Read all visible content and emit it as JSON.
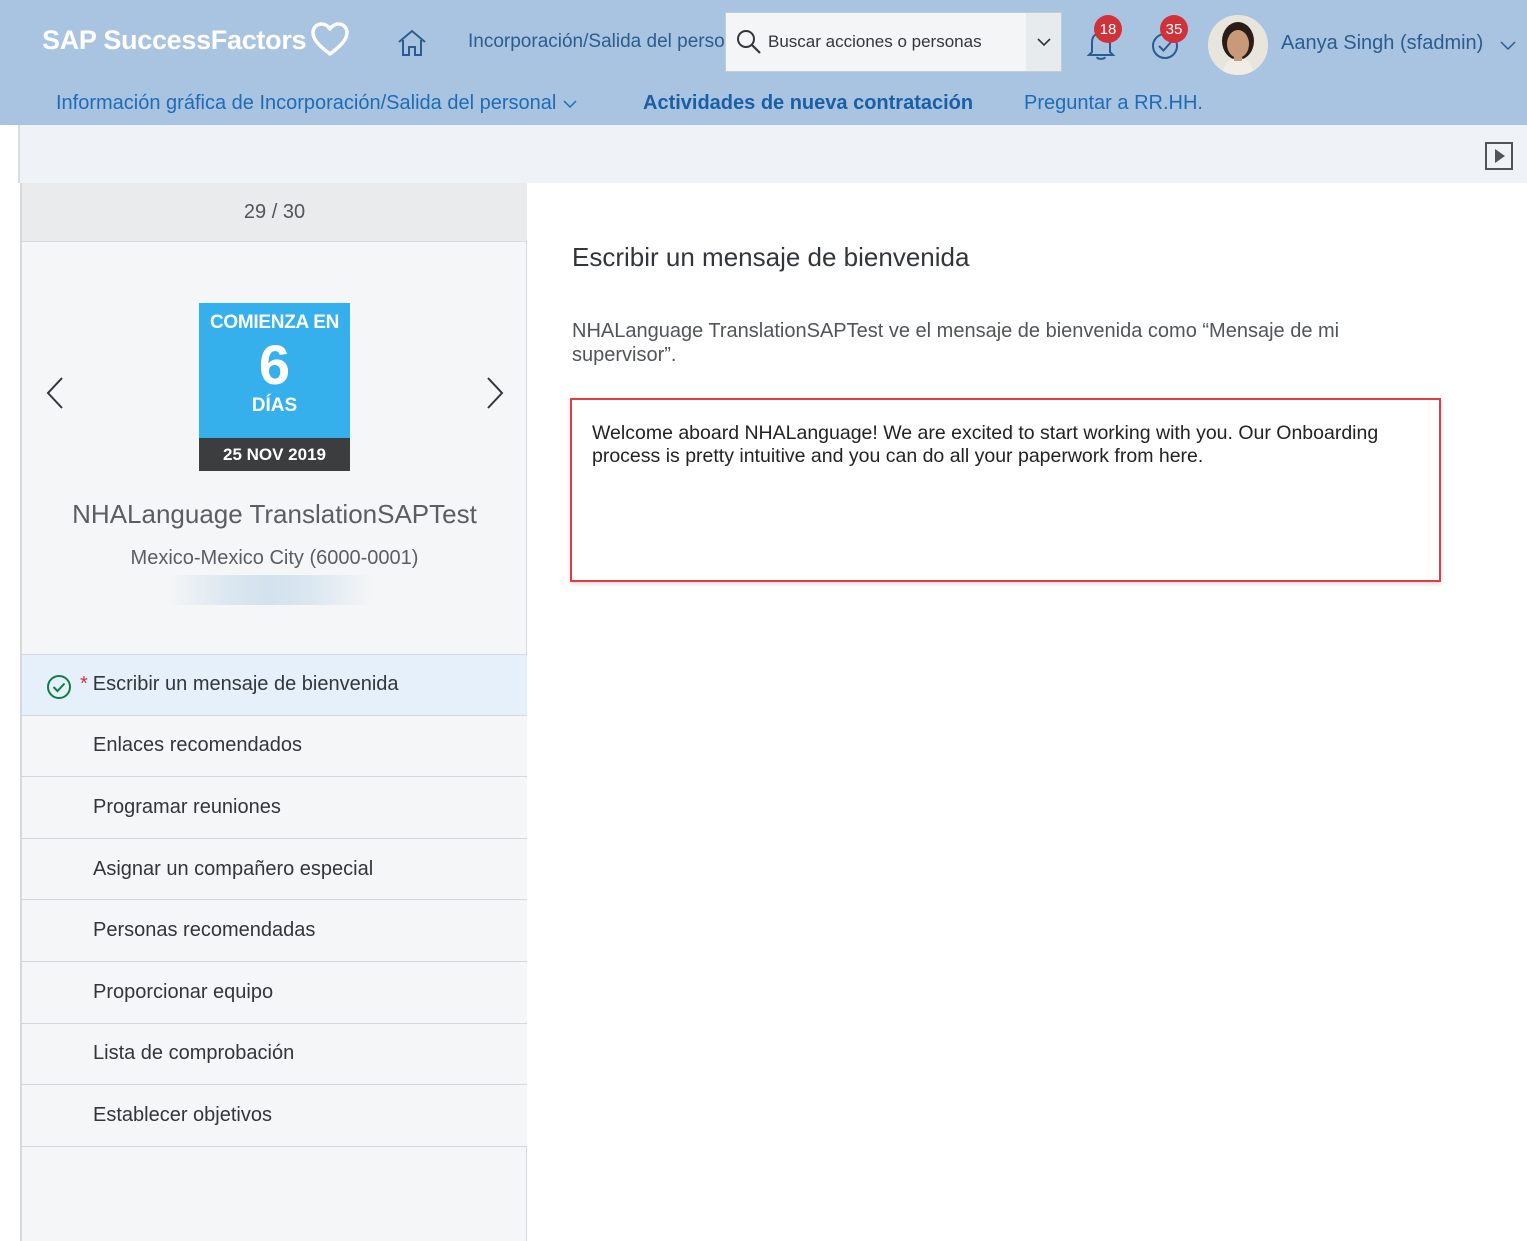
{
  "header": {
    "logo_text": "SAP SuccessFactors",
    "module_label": "Incorporación/Salida del personal",
    "search_placeholder": "Buscar acciones o personas",
    "notifications_count": "18",
    "todo_count": "35",
    "user_name": "Aanya Singh (sfadmin)"
  },
  "subnav": {
    "items": [
      {
        "label": "Información gráfica de Incorporación/Salida del personal"
      },
      {
        "label": "Actividades de nueva contratación"
      },
      {
        "label": "Preguntar a RR.HH."
      }
    ]
  },
  "sidebar": {
    "counter": "29 / 30",
    "calendar": {
      "line1": "COMIENZA EN",
      "number": "6",
      "line3": "DÍAS",
      "date": "25 NOV 2019"
    },
    "person_name": "NHALanguage TranslationSAPTest",
    "location": "Mexico-Mexico City (6000-0001)",
    "tasks": [
      {
        "label": "Escribir un mensaje de bienvenida",
        "required_marker": "*",
        "done": true
      },
      {
        "label": "Enlaces recomendados"
      },
      {
        "label": "Programar reuniones"
      },
      {
        "label": "Asignar un compañero especial"
      },
      {
        "label": "Personas recomendadas"
      },
      {
        "label": "Proporcionar equipo"
      },
      {
        "label": "Lista de comprobación"
      },
      {
        "label": "Establecer objetivos"
      }
    ]
  },
  "main": {
    "title": "Escribir un mensaje de bienvenida",
    "description": "NHALanguage TranslationSAPTest ve el mensaje de bienvenida como “Mensaje de mi supervisor”.",
    "message": "Welcome aboard NHALanguage! We are excited to start working with you. Our Onboarding process is pretty intuitive and you can do all your paperwork from here."
  },
  "icons": {
    "logo": "heart-icon",
    "home": "home-icon",
    "search": "search-icon",
    "notifications": "bell-icon",
    "todo": "check-circle-icon",
    "toolbar": "play-icon",
    "task_done": "check-circle-icon"
  },
  "colors": {
    "shell": "#a9c4e0",
    "link": "#0a6ed1",
    "calendar": "#35b0ec",
    "badge": "#d0323a",
    "highlight_border": "#e23c45",
    "success": "#107e3e"
  }
}
